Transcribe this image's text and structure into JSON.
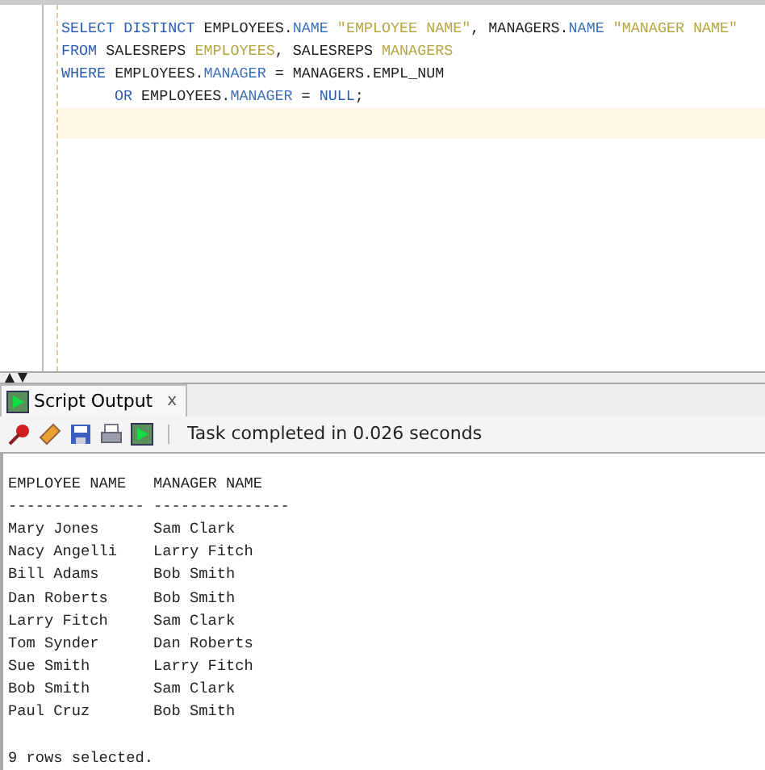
{
  "editor": {
    "lines": [
      {
        "current": false,
        "tokens": [
          {
            "text": "SELECT DISTINCT",
            "kind": "keyword"
          },
          {
            "text": " EMPLOYEES.",
            "kind": "plain"
          },
          {
            "text": "NAME",
            "kind": "field"
          },
          {
            "text": " \"EMPLOYEE NAME\"",
            "kind": "string"
          },
          {
            "text": ", MANAGERS.",
            "kind": "plain"
          },
          {
            "text": "NAME",
            "kind": "field"
          },
          {
            "text": " \"MANAGER NAME\"",
            "kind": "string"
          }
        ]
      },
      {
        "current": false,
        "tokens": [
          {
            "text": "FROM",
            "kind": "keyword"
          },
          {
            "text": " SALESREPS ",
            "kind": "plain"
          },
          {
            "text": "EMPLOYEES",
            "kind": "alias"
          },
          {
            "text": ", SALESREPS ",
            "kind": "plain"
          },
          {
            "text": "MANAGERS",
            "kind": "alias"
          }
        ]
      },
      {
        "current": false,
        "tokens": [
          {
            "text": "WHERE",
            "kind": "keyword"
          },
          {
            "text": " EMPLOYEES.",
            "kind": "plain"
          },
          {
            "text": "MANAGER",
            "kind": "field"
          },
          {
            "text": " = MANAGERS.EMPL_NUM",
            "kind": "plain"
          }
        ]
      },
      {
        "current": false,
        "indent": true,
        "tokens": [
          {
            "text": "OR",
            "kind": "keyword"
          },
          {
            "text": " EMPLOYEES.",
            "kind": "plain"
          },
          {
            "text": "MANAGER",
            "kind": "field"
          },
          {
            "text": " = ",
            "kind": "plain"
          },
          {
            "text": "NULL",
            "kind": "keyword"
          },
          {
            "text": ";",
            "kind": "plain"
          }
        ]
      },
      {
        "current": true
      }
    ]
  },
  "output_tab": {
    "title": "Script Output",
    "close": "x",
    "selected": true
  },
  "toolbar": {
    "status": "Task completed in 0.026 seconds"
  },
  "output": [
    "EMPLOYEE NAME   MANAGER NAME",
    "--------------- ---------------",
    "Mary Jones      Sam Clark",
    "Nacy Angelli    Larry Fitch",
    "Bill Adams      Bob Smith",
    "Dan Roberts     Bob Smith",
    "Larry Fitch     Sam Clark",
    "Tom Synder      Dan Roberts",
    "Sue Smith       Larry Fitch",
    "Bob Smith       Sam Clark",
    "Paul Cruz       Bob Smith"
  ],
  "footer": "9 rows selected."
}
